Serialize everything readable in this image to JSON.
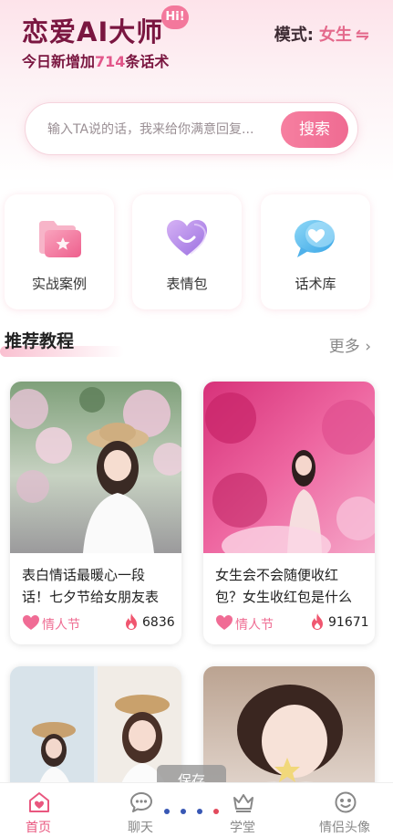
{
  "header": {
    "app_title": "恋爱AI大师",
    "hi_badge": "Hi!",
    "mode_label": "模式:",
    "mode_value": "女生",
    "subtitle_prefix": "今日新增加",
    "subtitle_count": "714",
    "subtitle_suffix": "条话术"
  },
  "search": {
    "placeholder": "输入TA说的话，我来给你满意回复...",
    "button_label": "搜索"
  },
  "features": [
    {
      "label": "实战案例",
      "icon": "folder-star-icon"
    },
    {
      "label": "表情包",
      "icon": "heart-smile-icon"
    },
    {
      "label": "话术库",
      "icon": "chat-heart-icon"
    }
  ],
  "tutorials": {
    "section_title": "推荐教程",
    "more_label": "更多",
    "articles": [
      {
        "title": "表白情话最暖心一段话！七夕节给女朋友表白的话",
        "tag": "情人节",
        "heat": "6836"
      },
      {
        "title": "女生会不会随便收红包？女生收红包是什么意思",
        "tag": "情人节",
        "heat": "91671"
      }
    ]
  },
  "tooltip": {
    "label": "保存"
  },
  "tabbar": {
    "items": [
      {
        "label": "首页",
        "icon": "home-heart-icon",
        "active": true
      },
      {
        "label": "聊天",
        "icon": "chat-bubble-icon",
        "active": false
      },
      {
        "label": "学堂",
        "icon": "crown-icon",
        "active": false
      },
      {
        "label": "情侣头像",
        "icon": "face-icon",
        "active": false
      }
    ]
  },
  "colors": {
    "brand": "#7a1640",
    "accent": "#ef6b92",
    "active_tab": "#e9577f"
  }
}
